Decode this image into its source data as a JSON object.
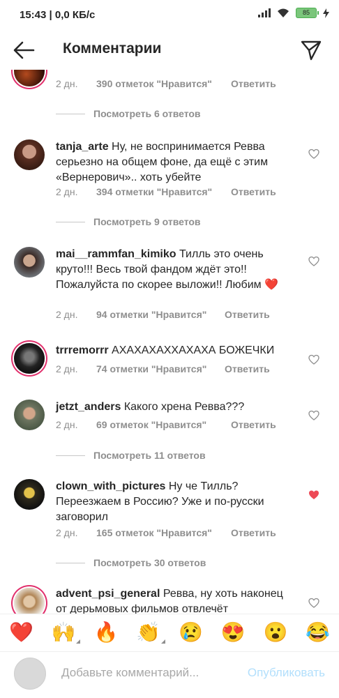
{
  "status": {
    "time": "15:43 | 0,0 КБ/с",
    "battery": "85"
  },
  "header": {
    "title": "Комментарии"
  },
  "comments": [
    {
      "user": "",
      "text": "",
      "when": "2 дн.",
      "likes": "390 отметок \"Нравится\"",
      "reply": "Ответить",
      "view_replies": "Посмотреть 6 ответов"
    },
    {
      "user": "tanja_arte",
      "text": "Ну, не воспринимается Ревва серьезно на общем фоне, да ещё  с этим «Вернерович».. хоть убейте",
      "when": "2 дн.",
      "likes": "394 отметки \"Нравится\"",
      "reply": "Ответить",
      "view_replies": "Посмотреть 9 ответов"
    },
    {
      "user": "mai__rammfan_kimiko",
      "text": "Тилль это очень круто!!! Весь твой фандом ждёт это!! Пожалуйста по скорее выложи!! Любим ❤️",
      "when": "2 дн.",
      "likes": "94 отметки \"Нравится\"",
      "reply": "Ответить"
    },
    {
      "user": "trrremorrr",
      "text": "АХАХАХАХХАХАХА БОЖЕЧКИ",
      "when": "2 дн.",
      "likes": "74 отметки \"Нравится\"",
      "reply": "Ответить"
    },
    {
      "user": "jetzt_anders",
      "text": "Какого хрена Ревва???",
      "when": "2 дн.",
      "likes": "69 отметок \"Нравится\"",
      "reply": "Ответить",
      "view_replies": "Посмотреть 11 ответов"
    },
    {
      "user": "clown_with_pictures",
      "text": "Ну че Тилль? Переезжаем в Россию? Уже и по-русски заговорил",
      "when": "2 дн.",
      "likes": "165 отметок \"Нравится\"",
      "reply": "Ответить",
      "view_replies": "Посмотреть 30 ответов",
      "liked": true
    },
    {
      "user": "advent_psi_general",
      "text": "Ревва, ну хоть наконец от дерьмовых фильмов отвлечёт"
    }
  ],
  "emojis": [
    "❤️",
    "🙌",
    "🔥",
    "👏",
    "😢",
    "😍",
    "😮",
    "😂"
  ],
  "composer": {
    "placeholder": "Добавьте комментарий...",
    "publish": "Опубликовать"
  },
  "colors": {
    "liked_heart": "#ed4956",
    "story_ring": "#e1306c",
    "publish_disabled": "#b2dffc"
  }
}
